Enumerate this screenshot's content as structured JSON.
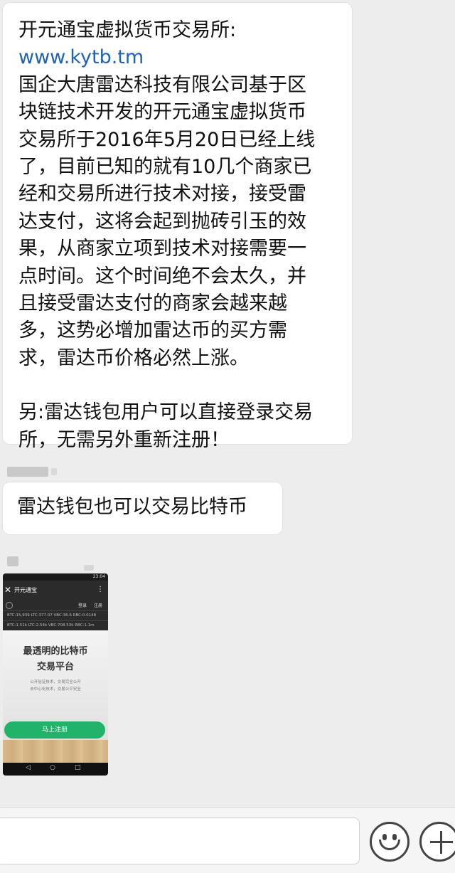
{
  "messages": [
    {
      "lines": [
        "开元通宝虚拟货币交易所:",
        "www.kytb.tm",
        "国企大唐雷达科技有限公司基于区",
        "块链技术开发的开元通宝虚拟货币",
        "交易所于2016年5月20日已经上线",
        "了，目前已知的就有10几个商家已",
        "经和交易所进行技术对接，接受雷",
        "达支付，这将会起到抛砖引玉的效",
        "果，从商家立项到技术对接需要一",
        "点时间。这个时间绝不会太久，并",
        "且接受雷达支付的商家会越来越",
        "多，这势必增加雷达币的买方需",
        "求，雷达币价格必然上涨。",
        "另:雷达钱包用户可以直接登录交易",
        "所，无需另外重新注册！"
      ]
    },
    {
      "text": "雷达钱包也可以交易比特币"
    }
  ],
  "phone_screenshot": {
    "status_time": "23:04",
    "title": "开元通宝",
    "back_icon": "back-arrow-icon",
    "menu_icon": "more-vertical-icon",
    "nav": {
      "login": "登录",
      "register": "注册"
    },
    "ticker_row1": "BTC:15,939  LTC:377.07  VBC:36.6  RBC:0.0148",
    "ticker_row2": "BTC:1.51k  LTC:2.54k  VBC:708.53k  RBC:1.1m",
    "headline_1": "最透明的比特币",
    "headline_2": "交易平台",
    "subtext_1": "公开验证技术，交易完全公开",
    "subtext_2": "去中心化技术，交易公平安全",
    "register_button": "马上注册",
    "softnav": [
      "◁",
      "○",
      "□"
    ]
  },
  "input_bar": {
    "emoji_icon": "emoji-icon",
    "plus_icon": "plus-icon"
  }
}
